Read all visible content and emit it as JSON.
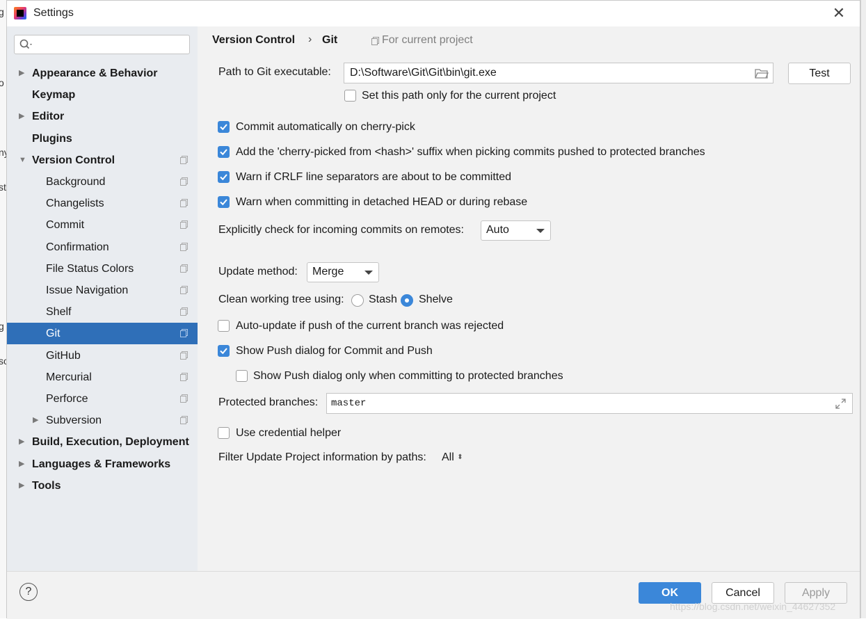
{
  "background": {
    "fragments": [
      "g",
      "o",
      "ny",
      "st",
      "g",
      "so"
    ]
  },
  "window": {
    "title": "Settings",
    "close_icon": "close-icon"
  },
  "sidebar": {
    "search": {
      "placeholder": "",
      "value": ""
    },
    "items": [
      {
        "label": "Appearance & Behavior",
        "bold": true,
        "arrow": "right"
      },
      {
        "label": "Keymap",
        "bold": true,
        "arrow": ""
      },
      {
        "label": "Editor",
        "bold": true,
        "arrow": "right"
      },
      {
        "label": "Plugins",
        "bold": true,
        "arrow": ""
      },
      {
        "label": "Version Control",
        "bold": true,
        "arrow": "down",
        "project_icon": true
      },
      {
        "label": "Background",
        "bold": false,
        "arrow": "",
        "project_icon": true
      },
      {
        "label": "Changelists",
        "bold": false,
        "arrow": "",
        "project_icon": true
      },
      {
        "label": "Commit",
        "bold": false,
        "arrow": "",
        "project_icon": true
      },
      {
        "label": "Confirmation",
        "bold": false,
        "arrow": "",
        "project_icon": true
      },
      {
        "label": "File Status Colors",
        "bold": false,
        "arrow": "",
        "project_icon": true
      },
      {
        "label": "Issue Navigation",
        "bold": false,
        "arrow": "",
        "project_icon": true
      },
      {
        "label": "Shelf",
        "bold": false,
        "arrow": "",
        "project_icon": true
      },
      {
        "label": "Git",
        "bold": false,
        "arrow": "",
        "project_icon": true,
        "selected": true
      },
      {
        "label": "GitHub",
        "bold": false,
        "arrow": "",
        "project_icon": true
      },
      {
        "label": "Mercurial",
        "bold": false,
        "arrow": "",
        "project_icon": true
      },
      {
        "label": "Perforce",
        "bold": false,
        "arrow": "",
        "project_icon": true
      },
      {
        "label": "Subversion",
        "bold": false,
        "arrow": "right",
        "project_icon": true
      },
      {
        "label": "Build, Execution, Deployment",
        "bold": true,
        "arrow": "right"
      },
      {
        "label": "Languages & Frameworks",
        "bold": true,
        "arrow": "right"
      },
      {
        "label": "Tools",
        "bold": true,
        "arrow": "right"
      }
    ]
  },
  "breadcrumb": {
    "parent": "Version Control",
    "separator": "›",
    "current": "Git",
    "scope": "For current project"
  },
  "git": {
    "path_label": "Path to Git executable:",
    "path_value": "D:\\Software\\Git\\Git\\bin\\git.exe",
    "test_button": "Test",
    "current_project_only": {
      "label": "Set this path only for the current project",
      "checked": false
    },
    "options": [
      {
        "label": "Commit automatically on cherry-pick",
        "checked": true
      },
      {
        "label": "Add the 'cherry-picked from <hash>' suffix when picking commits pushed to protected branches",
        "checked": true
      },
      {
        "label": "Warn if CRLF line separators are about to be committed",
        "checked": true
      },
      {
        "label": "Warn when committing in detached HEAD or during rebase",
        "checked": true
      }
    ],
    "incoming_label": "Explicitly check for incoming commits on remotes:",
    "incoming_value": "Auto",
    "update_method_label": "Update method:",
    "update_method_value": "Merge",
    "clean_tree_label": "Clean working tree using:",
    "clean_stash": "Stash",
    "clean_shelve": "Shelve",
    "clean_selected": "Shelve",
    "auto_update": {
      "label": "Auto-update if push of the current branch was rejected",
      "checked": false
    },
    "show_push": {
      "label": "Show Push dialog for Commit and Push",
      "checked": true
    },
    "show_push_protected": {
      "label": "Show Push dialog only when committing to protected branches",
      "checked": false
    },
    "protected_label": "Protected branches:",
    "protected_value": "master",
    "credential_helper": {
      "label": "Use credential helper",
      "checked": false
    },
    "filter_label": "Filter Update Project information by paths:",
    "filter_value": "All"
  },
  "footer": {
    "help": "?",
    "ok": "OK",
    "cancel": "Cancel",
    "apply": "Apply"
  },
  "watermark": "https://blog.csdn.net/weixin_44627352",
  "colors": {
    "accent": "#3b87d9",
    "selection": "#2f6fb8",
    "sidebar_bg": "#e9ecf0",
    "dialog_bg": "#f2f2f2"
  }
}
